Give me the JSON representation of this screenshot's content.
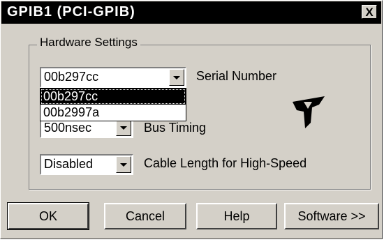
{
  "window": {
    "title": "GPIB1 (PCI-GPIB)",
    "close_glyph": "X"
  },
  "group": {
    "label": "Hardware Settings"
  },
  "serial": {
    "value": "00b297cc",
    "label": "Serial Number"
  },
  "dropdown": {
    "options": [
      "00b297cc",
      "00b2997a"
    ],
    "selected_index": 0
  },
  "bus_timing": {
    "value": "500nsec",
    "label": "Bus Timing"
  },
  "cable": {
    "value": "Disabled",
    "label": "Cable Length for High-Speed"
  },
  "buttons": {
    "ok": "OK",
    "cancel": "Cancel",
    "help": "Help",
    "software": "Software >>"
  },
  "icons": {
    "logo": "national-instruments-logo",
    "combo_arrow": "chevron-down-icon"
  }
}
